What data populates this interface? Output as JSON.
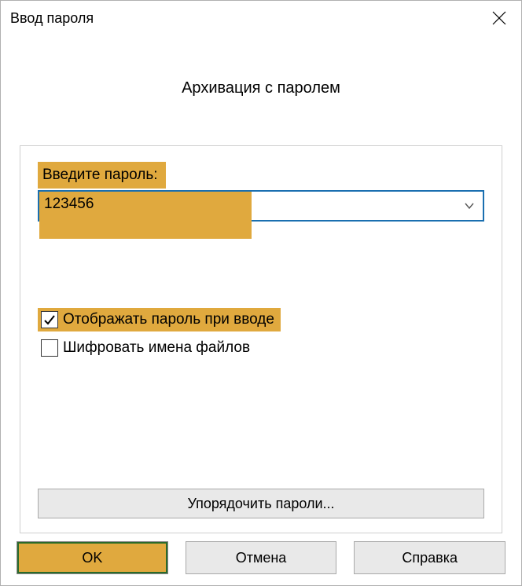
{
  "titlebar": {
    "title": "Ввод пароля"
  },
  "heading": "Архивация с паролем",
  "form": {
    "password_label": "Введите пароль:",
    "password_value": "123456"
  },
  "checks": {
    "show_password": "Отображать пароль при вводе",
    "encrypt_names": "Шифровать имена файлов"
  },
  "buttons": {
    "organize": "Упорядочить пароли...",
    "ok": "OK",
    "cancel": "Отмена",
    "help": "Справка"
  }
}
